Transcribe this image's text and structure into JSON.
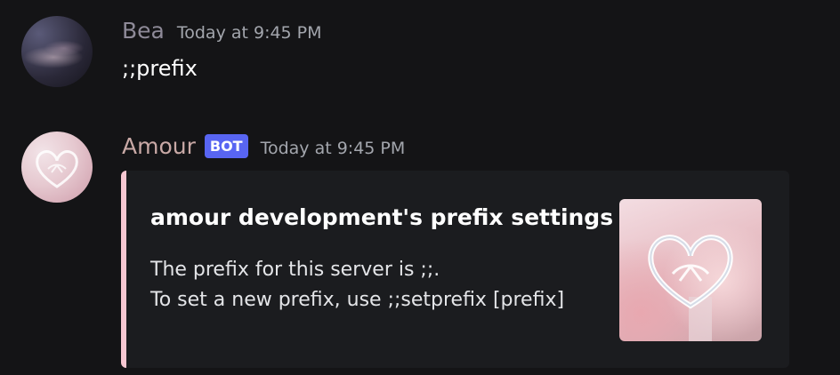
{
  "messages": [
    {
      "username": "Bea",
      "timestamp": "Today at 9:45 PM",
      "text": ";;prefix"
    },
    {
      "username": "Amour",
      "bot_tag": "BOT",
      "timestamp": "Today at 9:45 PM",
      "embed": {
        "title": "amour development's prefix settings",
        "description_lines": [
          "The prefix for this server is ;;.",
          "To set a new prefix, use ;;setprefix [prefix]"
        ],
        "accent_color": "#f7c7d2",
        "thumbnail_icon": "heart-logo-icon"
      }
    }
  ],
  "colors": {
    "background": "#141416",
    "bot_tag": "#5865f2",
    "bea_name": "#8e8a98",
    "amour_name": "#c9a9a6"
  }
}
